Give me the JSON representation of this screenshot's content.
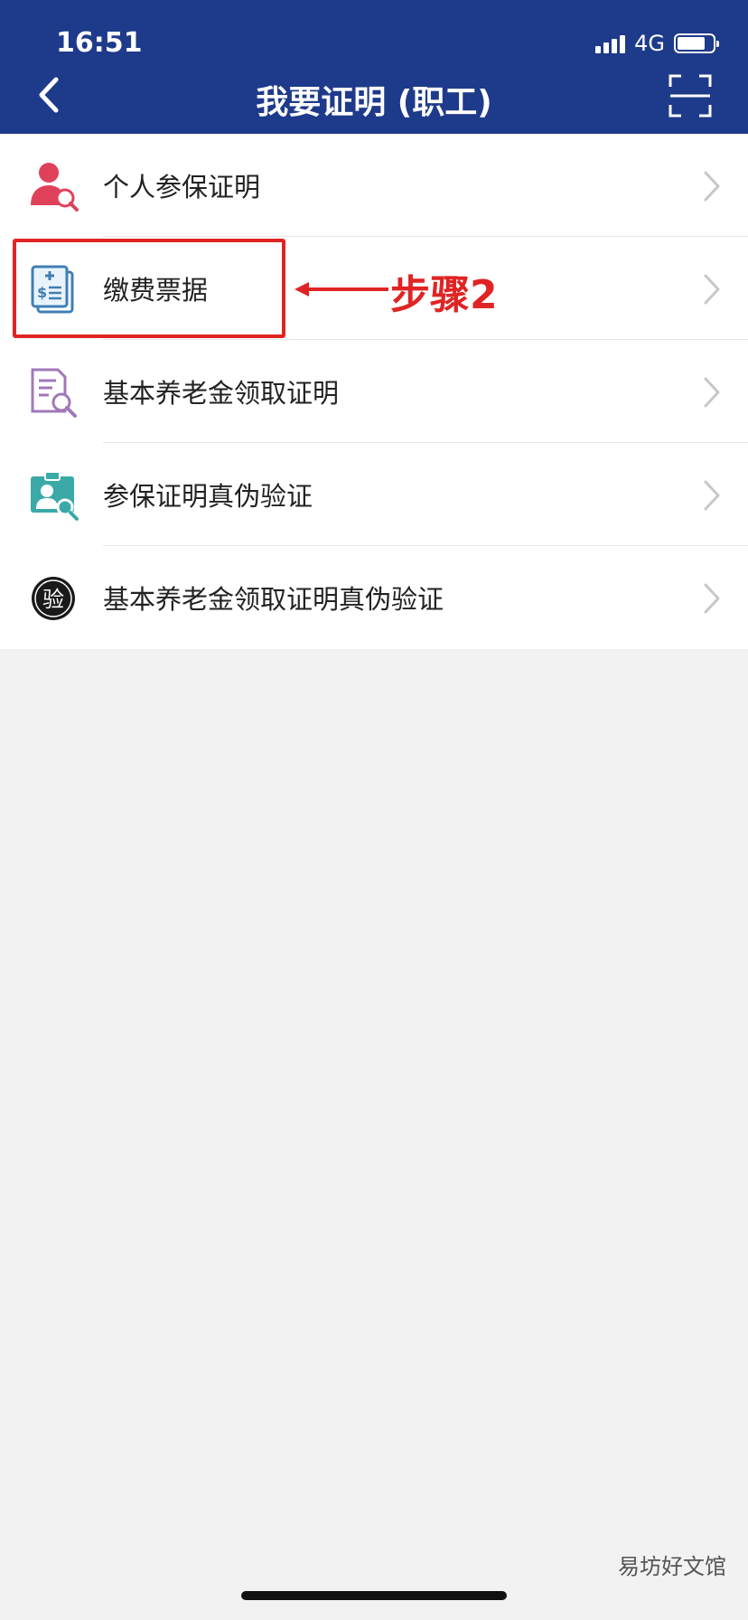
{
  "status_bar": {
    "time": "16:51",
    "network": "4G"
  },
  "header": {
    "title": "我要证明 (职工)",
    "back_icon": "chevron-left-icon",
    "scan_icon": "scan-frame-icon"
  },
  "list": {
    "items": [
      {
        "label": "个人参保证明",
        "icon": "person-search-icon"
      },
      {
        "label": "缴费票据",
        "icon": "receipt-icon"
      },
      {
        "label": "基本养老金领取证明",
        "icon": "document-search-icon"
      },
      {
        "label": "参保证明真伪验证",
        "icon": "id-card-search-icon"
      },
      {
        "label": "基本养老金领取证明真伪验证",
        "icon": "verify-badge-icon",
        "badge_text": "验"
      }
    ]
  },
  "annotation": {
    "step_label": "步骤2",
    "color": "#e02424"
  },
  "watermark": "易坊好文馆",
  "colors": {
    "header_bg": "#1e3a8a",
    "page_bg": "#f2f2f2"
  }
}
